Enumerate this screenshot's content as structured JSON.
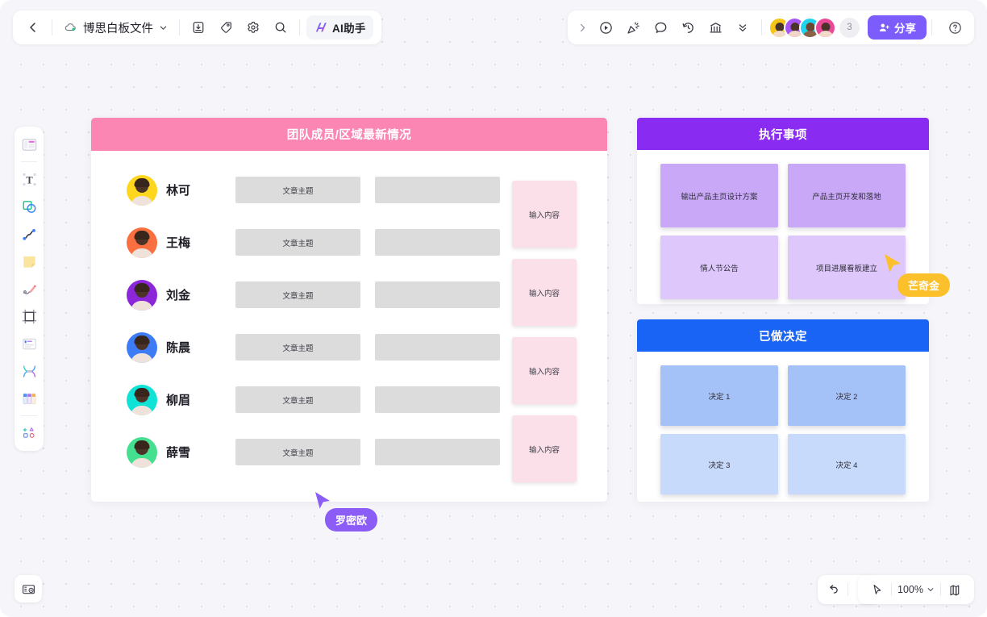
{
  "topbar": {
    "back_icon": "chevron-left-icon",
    "file_name": "博思白板文件",
    "file_dropdown_icon": "chevron-down-icon",
    "cloud_icon": "cloud-sync-icon",
    "tools": [
      {
        "name": "download-button",
        "icon": "download-icon"
      },
      {
        "name": "tag-button",
        "icon": "tag-icon"
      },
      {
        "name": "settings-button",
        "icon": "gear-icon"
      },
      {
        "name": "search-button",
        "icon": "search-icon"
      }
    ],
    "ai_label": "AI助手",
    "ai_icon": "ai-sparkle-icon",
    "right_tools": [
      {
        "name": "expand-button",
        "icon": "chevron-right-icon"
      },
      {
        "name": "present-button",
        "icon": "play-circle-icon"
      },
      {
        "name": "celebrate-button",
        "icon": "party-popper-icon"
      },
      {
        "name": "comment-button",
        "icon": "speech-bubble-icon"
      },
      {
        "name": "history-button",
        "icon": "clock-rewind-icon"
      },
      {
        "name": "template-button",
        "icon": "bank-icon"
      },
      {
        "name": "more-button",
        "icon": "double-chevron-down-icon"
      }
    ],
    "collaborators": [
      {
        "ring": "#f5c518",
        "skin": "#f3dbcb"
      },
      {
        "ring": "#a855f7",
        "skin": "#f0d8c8"
      },
      {
        "ring": "#22d3ee",
        "skin": "#8d6348"
      },
      {
        "ring": "#ec4899",
        "skin": "#f2d9c9"
      }
    ],
    "collaborator_overflow": "3",
    "share_label": "分享",
    "share_icon": "user-add-icon",
    "share_color": "#7c5cfa",
    "help_icon": "question-circle-icon"
  },
  "left_toolbar": {
    "items": [
      {
        "name": "tool-frame",
        "icon": "layout-frame-icon"
      },
      {
        "name": "tool-text",
        "icon": "text-t-icon"
      },
      {
        "name": "tool-shape",
        "icon": "shapes-icon"
      },
      {
        "name": "tool-connector",
        "icon": "curve-line-icon"
      },
      {
        "name": "tool-sticky-note",
        "icon": "sticky-note-icon"
      },
      {
        "name": "tool-pen",
        "icon": "pencil-scribble-icon"
      },
      {
        "name": "tool-crop",
        "icon": "crop-frame-icon"
      },
      {
        "name": "tool-card",
        "icon": "card-list-icon"
      },
      {
        "name": "tool-mindmap",
        "icon": "mindmap-icon"
      },
      {
        "name": "tool-kanban",
        "icon": "kanban-columns-icon"
      },
      {
        "name": "tool-more-shapes",
        "icon": "plus-shapes-icon"
      }
    ]
  },
  "bottom_bar": {
    "media_button_icon": "media-panel-icon",
    "undo_icon": "undo-arrow-icon",
    "redo_icon": "redo-arrow-icon",
    "pointer_icon": "cursor-arrow-icon",
    "zoom_level": "100%",
    "zoom_dropdown_icon": "chevron-down-icon",
    "minimap_icon": "minimap-book-icon"
  },
  "main_board": {
    "title": "团队成员/区域最新情况",
    "header_color": "#fb86b3",
    "rows": [
      {
        "name": "林可",
        "avatar_color": "#ffd61e",
        "topic": "文章主题",
        "second": ""
      },
      {
        "name": "王梅",
        "avatar_color": "#fa6f3f",
        "topic": "文章主题",
        "second": ""
      },
      {
        "name": "刘金",
        "avatar_color": "#8b27d8",
        "topic": "文章主题",
        "second": ""
      },
      {
        "name": "陈晨",
        "avatar_color": "#3d7bf7",
        "topic": "文章主题",
        "second": ""
      },
      {
        "name": "柳眉",
        "avatar_color": "#0fe3d8",
        "topic": "文章主题",
        "second": ""
      },
      {
        "name": "薛雪",
        "avatar_color": "#45e08f",
        "topic": "文章主题",
        "second": ""
      }
    ],
    "notes": [
      "输入内容",
      "输入内容",
      "输入内容",
      "输入内容"
    ],
    "note_color": "#fbe0e9"
  },
  "panels": [
    {
      "key": "actions",
      "title": "执行事项",
      "header_color": "#8a2bf2",
      "cards": [
        {
          "text": "输出产品主页设计方案",
          "color": "#c9a8f7"
        },
        {
          "text": "产品主页开发和落地",
          "color": "#c9a8f7"
        },
        {
          "text": "情人节公告",
          "color": "#ddc7fb"
        },
        {
          "text": "项目进展看板建立",
          "color": "#ddc7fb"
        }
      ]
    },
    {
      "key": "decisions",
      "title": "已做决定",
      "header_color": "#1a64f5",
      "cards": [
        {
          "text": "决定 1",
          "color": "#a5c2f8"
        },
        {
          "text": "决定 2",
          "color": "#a5c2f8"
        },
        {
          "text": "决定 3",
          "color": "#c7dafb"
        },
        {
          "text": "决定 4",
          "color": "#c7dafb"
        }
      ]
    }
  ],
  "cursors": [
    {
      "key": "mangqijin",
      "label": "芒奇金",
      "color": "#fbc02a"
    },
    {
      "key": "luomiou",
      "label": "罗密欧",
      "color": "#8b5cf6"
    }
  ]
}
